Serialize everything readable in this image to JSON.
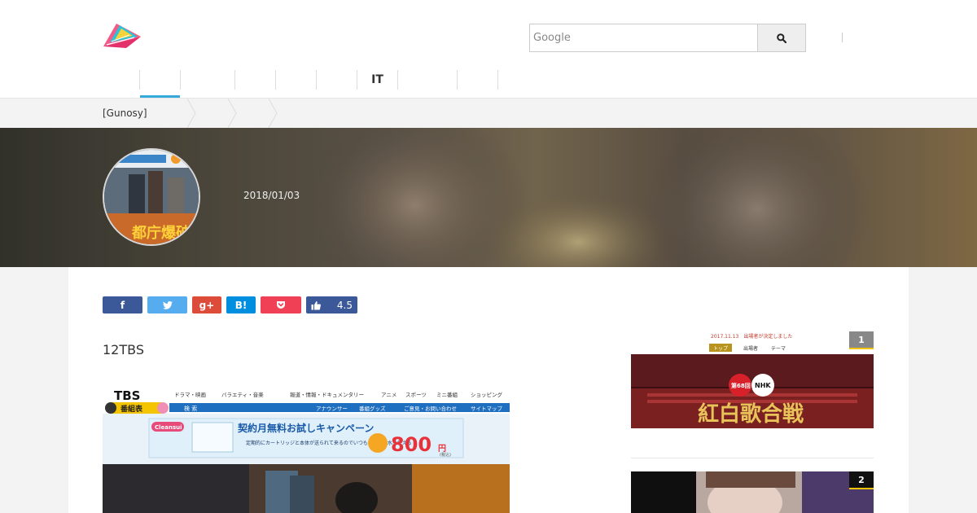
{
  "header": {
    "search_placeholder": "Google",
    "nav": [
      {
        "label": "",
        "active": true
      },
      {
        "label": ""
      },
      {
        "label": ""
      },
      {
        "label": ""
      },
      {
        "label": ""
      },
      {
        "label": ""
      },
      {
        "label": "IT"
      },
      {
        "label": ""
      },
      {
        "label": ""
      }
    ]
  },
  "breadcrumb": {
    "items": [
      "[Gunosy]",
      "",
      "",
      ""
    ]
  },
  "article": {
    "date": "2018/01/03",
    "title": "12TBS",
    "rating": "4.5"
  },
  "share": {
    "facebook": "f",
    "gplus": "g+",
    "hatena": "B!"
  },
  "screenshot_tbs": {
    "logo": "TBS",
    "guide": "番組表",
    "nav": [
      "ドラマ・映画",
      "バラエティ・音楽",
      "報道・情報・ドキュメンタリー",
      "アニメ",
      "スポーツ",
      "ミニ番組",
      "ショッピング"
    ],
    "subnav": [
      "検 索",
      "アナウンサー",
      "番組グッズ",
      "ご意見・お問い合わせ",
      "サイトマップ"
    ],
    "ad_brand": "Cleansui",
    "ad_title": "契約月無料お試しキャンペーン",
    "ad_body": "定期的にカートリッジと本体が送られて来るのでいつもキレイな水を使える",
    "ad_price": "800",
    "ad_unit": "円",
    "ad_tax": "(税込)"
  },
  "thumb_caption": "都庁爆破",
  "ranking": [
    {
      "rank": "1",
      "notice": "2017.11.13　出場者が決定しました",
      "tabs": [
        "トップ",
        "出場者",
        "テーマ"
      ],
      "badge": "第68回",
      "logo": "NHK",
      "title": "紅白歌合戦"
    },
    {
      "rank": "2"
    }
  ],
  "colors": {
    "accent": "#35a9d9",
    "facebook": "#3b5998",
    "twitter": "#55acee",
    "gplus": "#dd4b39",
    "hatena": "#008fde",
    "pocket": "#ef4056",
    "like": "#3b5998",
    "rank_badge": "#888888",
    "rank_line": "#f5c400"
  }
}
